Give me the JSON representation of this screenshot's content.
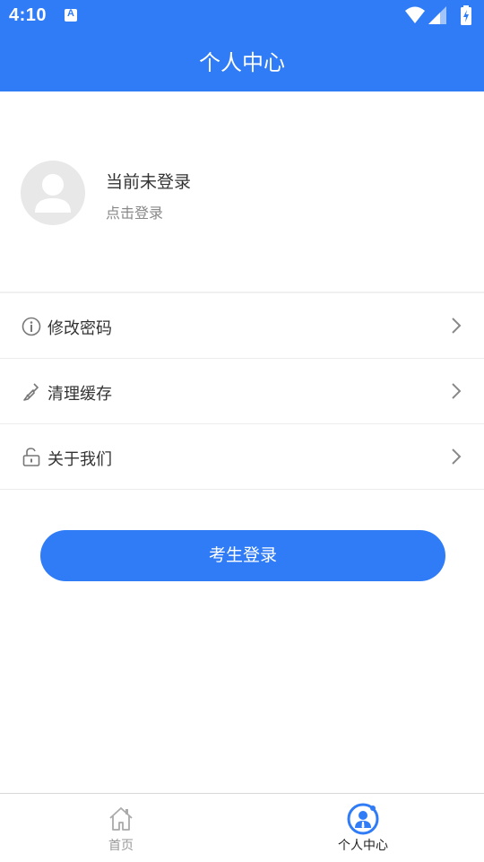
{
  "status_bar": {
    "time": "4:10",
    "notification_icon": "A",
    "icons": [
      "wifi-icon",
      "signal-icon",
      "battery-charging-icon"
    ]
  },
  "header": {
    "title": "个人中心"
  },
  "profile": {
    "status_text": "当前未登录",
    "action_text": "点击登录",
    "avatar_icon": "user-placeholder-icon"
  },
  "menu": {
    "items": [
      {
        "label": "修改密码",
        "icon": "info-icon"
      },
      {
        "label": "清理缓存",
        "icon": "broom-icon"
      },
      {
        "label": "关于我们",
        "icon": "unlock-icon"
      }
    ]
  },
  "login_button": {
    "label": "考生登录"
  },
  "tabbar": {
    "tabs": [
      {
        "label": "首页",
        "icon": "home-icon",
        "active": false
      },
      {
        "label": "个人中心",
        "icon": "user-center-icon",
        "active": true
      }
    ]
  },
  "colors": {
    "primary": "#2f7cf6",
    "text": "#333333",
    "subtext": "#888888",
    "inactive": "#999999"
  }
}
